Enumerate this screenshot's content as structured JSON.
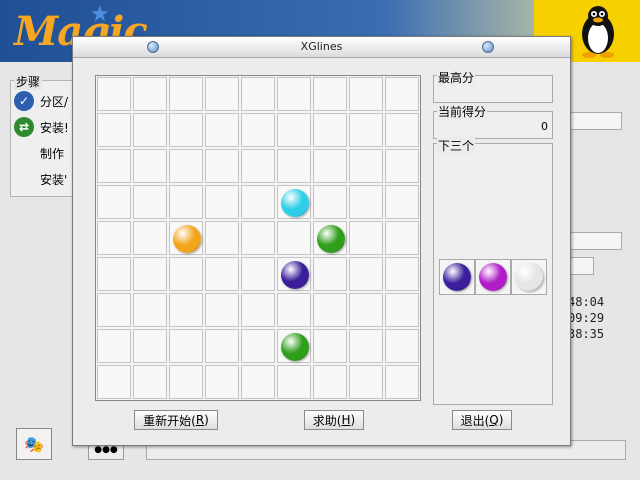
{
  "installer": {
    "logo_text": "Magic",
    "steps_title": "步骤",
    "steps": [
      {
        "label": "分区/",
        "icon": "checkmark-icon",
        "color": "#2d5fb0"
      },
      {
        "label": "安装!",
        "icon": "exchange-arrows-icon",
        "color": "#2f8a2f"
      },
      {
        "label": "制作",
        "icon": "",
        "color": ""
      },
      {
        "label": "安装'",
        "icon": "",
        "color": ""
      }
    ],
    "times": [
      "48:04",
      "09:29",
      "38:35"
    ]
  },
  "window": {
    "title": "XGlines",
    "high_score_label": "最高分",
    "high_score_value": "",
    "current_score_label": "当前得分",
    "current_score_value": "0",
    "next_three_label": "下三个",
    "next_balls": [
      {
        "color": "purple",
        "hex": "#3a1e9a"
      },
      {
        "color": "magenta",
        "hex": "#b01cc8"
      },
      {
        "color": "white",
        "hex": "#e6e6e6"
      }
    ],
    "buttons": {
      "restart": {
        "text": "重新开始(",
        "key": "R",
        "end": ")"
      },
      "help": {
        "text": "求助(",
        "key": "H",
        "end": ")"
      },
      "quit": {
        "text": "退出(",
        "key": "Q",
        "end": ")"
      }
    }
  },
  "board": {
    "rows": 9,
    "cols": 9,
    "balls": [
      {
        "row": 3,
        "col": 5,
        "color": "cyan",
        "hex": "#2ecde8"
      },
      {
        "row": 4,
        "col": 2,
        "color": "orange",
        "hex": "#f2a51a"
      },
      {
        "row": 4,
        "col": 6,
        "color": "green",
        "hex": "#2f9e1a"
      },
      {
        "row": 5,
        "col": 5,
        "color": "purple",
        "hex": "#3a1e9a"
      },
      {
        "row": 7,
        "col": 5,
        "color": "green",
        "hex": "#2f9e1a"
      }
    ]
  }
}
